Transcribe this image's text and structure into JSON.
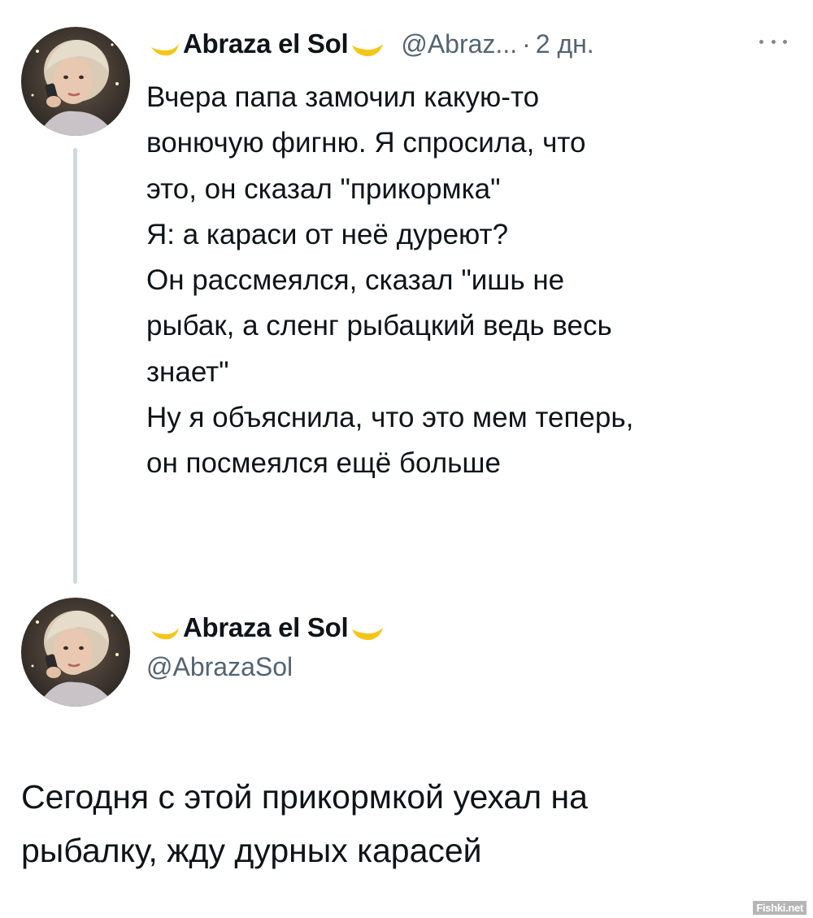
{
  "tweet1": {
    "author_name": "Abraza el Sol",
    "handle": "@Abraz...",
    "separator": "·",
    "time_ago": "2 дн.",
    "lines": [
      "Вчера папа замочил какую-то",
      "вонючую фигню. Я спросила, что",
      "это, он сказал \"прикормка\"",
      "Я: а караси от неё дуреют?",
      "Он рассмеялся, сказал \"ишь не",
      "рыбак, а сленг рыбацкий ведь весь",
      "знает\"",
      "Ну я объяснила, что это мем теперь,",
      "он посмеялся ещё больше"
    ],
    "more_icon": "more-horizontal-icon"
  },
  "tweet2": {
    "author_name": "Abraza el Sol",
    "handle": "@AbrazaSol",
    "lines": [
      "Сегодня с этой прикормкой уехал на",
      "рыбалку, жду дурных карасей"
    ]
  },
  "decor": {
    "moon_icon": "crescent-moon-icon",
    "moon_color": "#f5c518",
    "thread_line_color": "#cfd9de"
  },
  "watermark": "Fishki.net"
}
